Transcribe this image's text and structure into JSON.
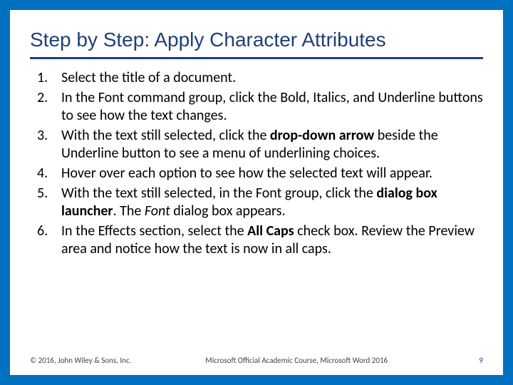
{
  "title": "Step by Step: Apply Character Attributes",
  "steps": {
    "s1": "Select the title of a document.",
    "s2": "In the Font command group, click the Bold, Italics, and Underline buttons to see how the text changes.",
    "s3a": "With the text still selected, click the ",
    "s3b": "drop-down arrow",
    "s3c": " beside the Underline button to see a menu of underlining choices.",
    "s4": "Hover over each option to see how the selected text will appear.",
    "s5a": "With the text still selected, in the Font group, click the ",
    "s5b": "dialog box launcher",
    "s5c": ". The ",
    "s5d": "Font",
    "s5e": " dialog box appears.",
    "s6a": "In the Effects section, select the ",
    "s6b": "All Caps ",
    "s6c": "check box. Review the Preview area and notice how the text is now in all caps."
  },
  "footer": {
    "left": "© 2016, John Wiley & Sons, Inc.",
    "center": "Microsoft Official Academic Course, Microsoft Word 2016",
    "right": "9"
  }
}
